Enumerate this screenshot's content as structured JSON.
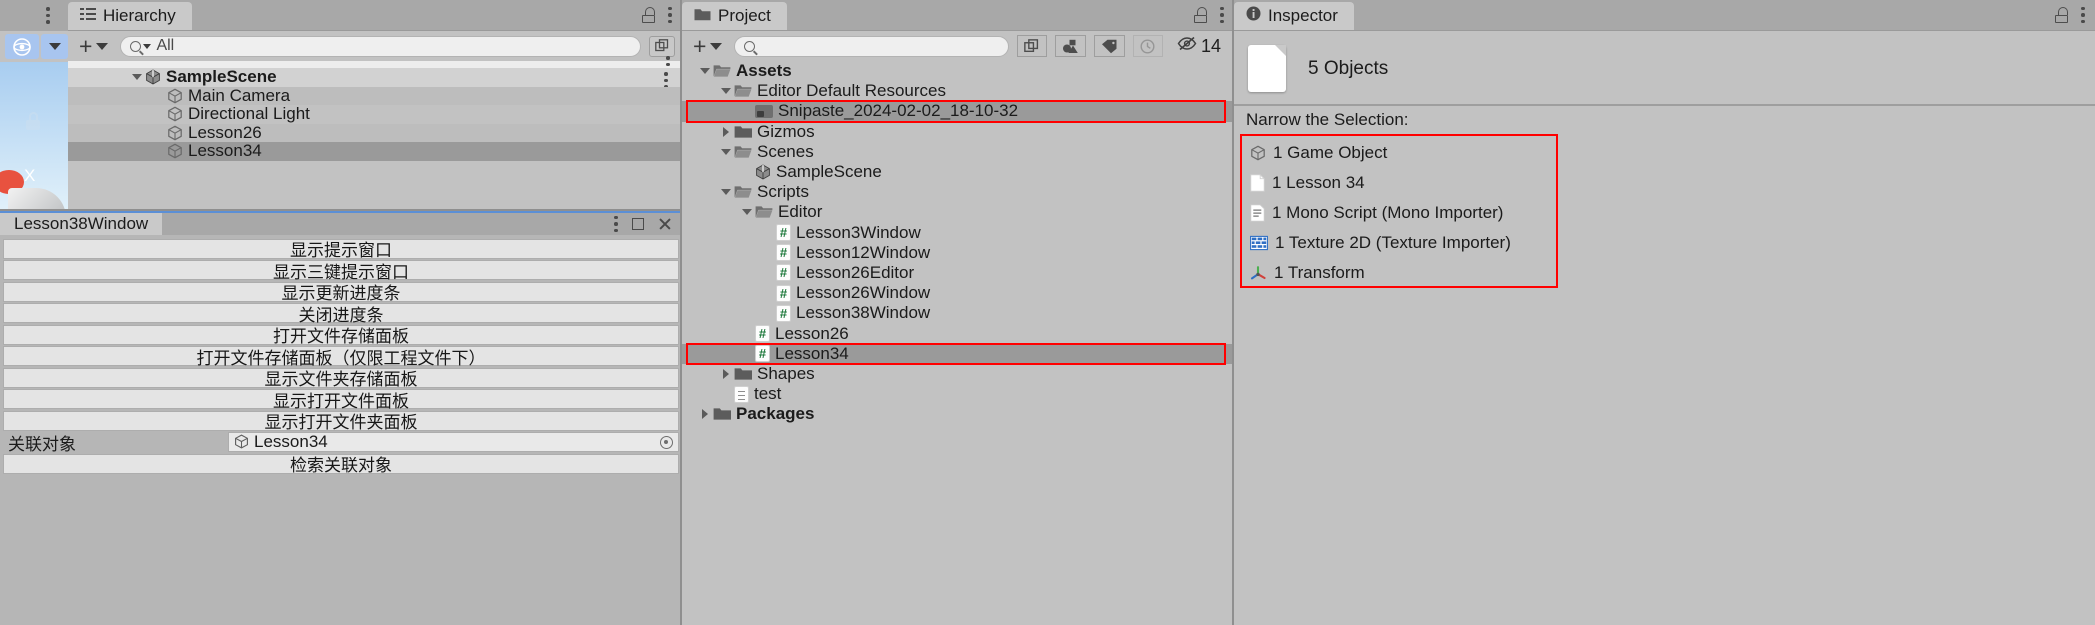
{
  "app": "Unity Editor",
  "scene_view": {
    "gizmo_icon": "orientation-gizmo-icon",
    "axis_label": "X",
    "lock_icon": "lock-icon"
  },
  "hierarchy": {
    "tab_label": "Hierarchy",
    "tab_icon": "hierarchy-icon",
    "lock_icon": "lock-icon",
    "menu_icon": "kebab-menu-icon",
    "add_label": "+",
    "search_placeholder": "All",
    "search_value": "All",
    "expand_icon": "expand-search-icon",
    "rows": [
      {
        "label": "SampleScene",
        "icon": "unity-scene-icon",
        "depth": 1,
        "twisty": "down",
        "bold": true,
        "selected": false
      },
      {
        "label": "Main Camera",
        "icon": "gameobject-icon",
        "depth": 2,
        "twisty": "none",
        "bold": false,
        "selected": false
      },
      {
        "label": "Directional Light",
        "icon": "gameobject-icon",
        "depth": 2,
        "twisty": "none",
        "bold": false,
        "selected": false
      },
      {
        "label": "Lesson26",
        "icon": "gameobject-icon",
        "depth": 2,
        "twisty": "none",
        "bold": false,
        "selected": false
      },
      {
        "label": "Lesson34",
        "icon": "gameobject-icon",
        "depth": 2,
        "twisty": "none",
        "bold": false,
        "selected": true
      }
    ]
  },
  "lesson38_window": {
    "tab_label": "Lesson38Window",
    "menu_icon": "kebab-menu-icon",
    "maximize_icon": "maximize-icon",
    "close_icon": "close-icon",
    "buttons": [
      "显示提示窗口",
      "显示三键提示窗口",
      "显示更新进度条",
      "关闭进度条",
      "打开文件存储面板",
      "打开文件存储面板（仅限工程文件下）",
      "显示文件夹存储面板",
      "显示打开文件面板",
      "显示打开文件夹面板"
    ],
    "object_field": {
      "label": "关联对象",
      "value": "Lesson34",
      "icon": "gameobject-icon",
      "picker_icon": "object-picker-icon"
    },
    "footer_button": "检索关联对象"
  },
  "project": {
    "tab_label": "Project",
    "tab_icon": "folder-icon",
    "lock_icon": "lock-icon",
    "menu_icon": "kebab-menu-icon",
    "add_label": "+",
    "search_value": "",
    "toolbar_icons": [
      {
        "name": "expand-search-icon",
        "glyph": "expand",
        "active": true
      },
      {
        "name": "filter-by-type-icon",
        "glyph": "shapes",
        "active": true
      },
      {
        "name": "filter-by-label-icon",
        "glyph": "tag",
        "active": true
      },
      {
        "name": "history-icon",
        "glyph": "clock",
        "active": false
      }
    ],
    "hidden_count_icon": "eye-off-icon",
    "hidden_count": "14",
    "rows": [
      {
        "label": "Assets",
        "icon": "folder-open-icon",
        "depth": 0,
        "twisty": "down",
        "bold": true,
        "selected": false,
        "highlight": false
      },
      {
        "label": "Editor Default Resources",
        "icon": "folder-open-icon",
        "depth": 1,
        "twisty": "down",
        "bold": false,
        "selected": false,
        "highlight": false
      },
      {
        "label": "Snipaste_2024-02-02_18-10-32",
        "icon": "texture-icon",
        "depth": 2,
        "twisty": "none",
        "bold": false,
        "selected": true,
        "highlight": true
      },
      {
        "label": "Gizmos",
        "icon": "folder-icon",
        "depth": 1,
        "twisty": "right",
        "bold": false,
        "selected": false,
        "highlight": false
      },
      {
        "label": "Scenes",
        "icon": "folder-open-icon",
        "depth": 1,
        "twisty": "down",
        "bold": false,
        "selected": false,
        "highlight": false
      },
      {
        "label": "SampleScene",
        "icon": "unity-scene-icon",
        "depth": 2,
        "twisty": "none",
        "bold": false,
        "selected": false,
        "highlight": false
      },
      {
        "label": "Scripts",
        "icon": "folder-open-icon",
        "depth": 1,
        "twisty": "down",
        "bold": false,
        "selected": false,
        "highlight": false
      },
      {
        "label": "Editor",
        "icon": "folder-open-icon",
        "depth": 2,
        "twisty": "down",
        "bold": false,
        "selected": false,
        "highlight": false
      },
      {
        "label": "Lesson3Window",
        "icon": "csharp-script-icon",
        "depth": 3,
        "twisty": "none",
        "bold": false,
        "selected": false,
        "highlight": false
      },
      {
        "label": "Lesson12Window",
        "icon": "csharp-script-icon",
        "depth": 3,
        "twisty": "none",
        "bold": false,
        "selected": false,
        "highlight": false
      },
      {
        "label": "Lesson26Editor",
        "icon": "csharp-script-icon",
        "depth": 3,
        "twisty": "none",
        "bold": false,
        "selected": false,
        "highlight": false
      },
      {
        "label": "Lesson26Window",
        "icon": "csharp-script-icon",
        "depth": 3,
        "twisty": "none",
        "bold": false,
        "selected": false,
        "highlight": false
      },
      {
        "label": "Lesson38Window",
        "icon": "csharp-script-icon",
        "depth": 3,
        "twisty": "none",
        "bold": false,
        "selected": false,
        "highlight": false
      },
      {
        "label": "Lesson26",
        "icon": "csharp-script-icon",
        "depth": 2,
        "twisty": "none",
        "bold": false,
        "selected": false,
        "highlight": false
      },
      {
        "label": "Lesson34",
        "icon": "csharp-script-icon",
        "depth": 2,
        "twisty": "none",
        "bold": false,
        "selected": true,
        "highlight": true
      },
      {
        "label": "Shapes",
        "icon": "folder-icon",
        "depth": 1,
        "twisty": "right",
        "bold": false,
        "selected": false,
        "highlight": false
      },
      {
        "label": "test",
        "icon": "text-asset-icon",
        "depth": 1,
        "twisty": "none",
        "bold": false,
        "selected": false,
        "highlight": false
      },
      {
        "label": "Packages",
        "icon": "folder-icon",
        "depth": 0,
        "twisty": "right",
        "bold": true,
        "selected": false,
        "highlight": false
      }
    ]
  },
  "inspector": {
    "tab_label": "Inspector",
    "tab_icon": "info-icon",
    "lock_icon": "lock-icon",
    "menu_icon": "kebab-menu-icon",
    "selection_title": "5 Objects",
    "selection_icon": "multi-object-icon",
    "narrow_label": "Narrow the Selection:",
    "narrow_items": [
      {
        "label": "1 Game Object",
        "icon": "gameobject-icon"
      },
      {
        "label": "1 Lesson 34",
        "icon": "blank-document-icon"
      },
      {
        "label": "1 Mono Script (Mono Importer)",
        "icon": "mono-script-icon"
      },
      {
        "label": "1 Texture 2D (Texture Importer)",
        "icon": "texture2d-icon"
      },
      {
        "label": "1 Transform",
        "icon": "transform-icon"
      }
    ]
  },
  "colors": {
    "panel_bg": "#c2c2c2",
    "tabstrip_bg": "#a8a8a8",
    "tab_bg": "#c9c9c9",
    "selection": "#9a9a9a",
    "highlight_red": "#ff0000",
    "accent_blue": "#5b8fd6",
    "script_green": "#1f7a3d"
  }
}
